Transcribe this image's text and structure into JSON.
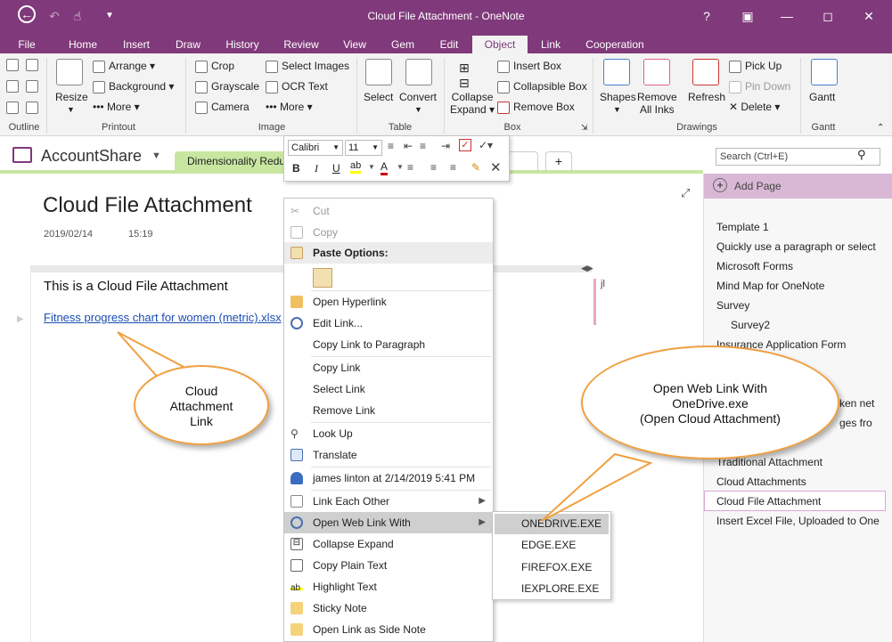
{
  "window": {
    "title": "Cloud File Attachment - OneNote",
    "help": "?"
  },
  "tabs": [
    "File",
    "Home",
    "Insert",
    "Draw",
    "History",
    "Review",
    "View",
    "Gem",
    "Edit",
    "Object",
    "Link",
    "Cooperation"
  ],
  "ribbon": {
    "outline": {
      "label": "Outline"
    },
    "printout": {
      "resize": "Resize",
      "arrange": "Arrange",
      "background": "Background",
      "more": "More",
      "label": "Printout"
    },
    "image": {
      "crop": "Crop",
      "grayscale": "Grayscale",
      "camera": "Camera",
      "select_images": "Select Images",
      "ocr_text": "OCR Text",
      "more": "More",
      "label": "Image"
    },
    "table": {
      "select": "Select",
      "convert": "Convert",
      "label": "Table"
    },
    "box": {
      "collapse1": "Collapse",
      "collapse2": "Expand",
      "insert_box": "Insert Box",
      "collapsible_box": "Collapsible Box",
      "remove_box": "Remove Box",
      "label": "Box"
    },
    "drawings": {
      "shapes": "Shapes",
      "remove1": "Remove",
      "remove2": "All Inks",
      "refresh": "Refresh",
      "pick_up": "Pick Up",
      "pin_down": "Pin Down",
      "delete": "Delete",
      "label": "Drawings"
    },
    "gantt": {
      "gantt": "Gantt",
      "label": "Gantt"
    }
  },
  "notebook": {
    "name": "AccountShare",
    "section_tab": "Dimensionality Redu",
    "search_placeholder": "Search (Ctrl+E)"
  },
  "format_toolbar": {
    "font": "Calibri",
    "size": "11"
  },
  "page": {
    "title": "Cloud File Attachment",
    "date": "2019/02/14",
    "time": "15:19",
    "body_text": "This is a Cloud File Attachment",
    "link_text": "Fitness progress chart for women (metric).xlsx",
    "author_initials": "jl"
  },
  "context_menu": {
    "cut": "Cut",
    "copy": "Copy",
    "paste_options": "Paste Options:",
    "open_hyperlink": "Open Hyperlink",
    "edit_link": "Edit Link...",
    "copy_link_para": "Copy Link to Paragraph",
    "copy_link": "Copy Link",
    "select_link": "Select Link",
    "remove_link": "Remove Link",
    "look_up": "Look Up",
    "translate": "Translate",
    "author": "james linton at 2/14/2019 5:41 PM",
    "link_each_other": "Link Each Other",
    "open_web_link": "Open Web Link With",
    "collapse_expand": "Collapse Expand",
    "copy_plain": "Copy Plain Text",
    "highlight": "Highlight Text",
    "sticky": "Sticky Note",
    "side_note": "Open Link as Side Note"
  },
  "submenu": [
    "ONEDRIVE.EXE",
    "EDGE.EXE",
    "FIREFOX.EXE",
    "IEXPLORE.EXE"
  ],
  "pages": {
    "add_page": "Add Page",
    "list": [
      "Template 1",
      "Quickly use a paragraph or select",
      "Microsoft Forms",
      "Mind Map for OneNote",
      "Survey",
      "Survey2",
      "Insurance Application Form",
      "ken net",
      "ges fro",
      "Traditional Attachment",
      "Cloud Attachments",
      "Cloud File Attachment",
      "Insert Excel File, Uploaded to One"
    ]
  },
  "callouts": {
    "left": [
      "Cloud",
      "Attachment",
      "Link"
    ],
    "right": [
      "Open Web Link With",
      "OneDrive.exe",
      "(Open Cloud Attachment)"
    ]
  },
  "colors": {
    "brand": "#80397b",
    "callout_border": "#f0a040",
    "section_tab": "#c8e6a0"
  }
}
